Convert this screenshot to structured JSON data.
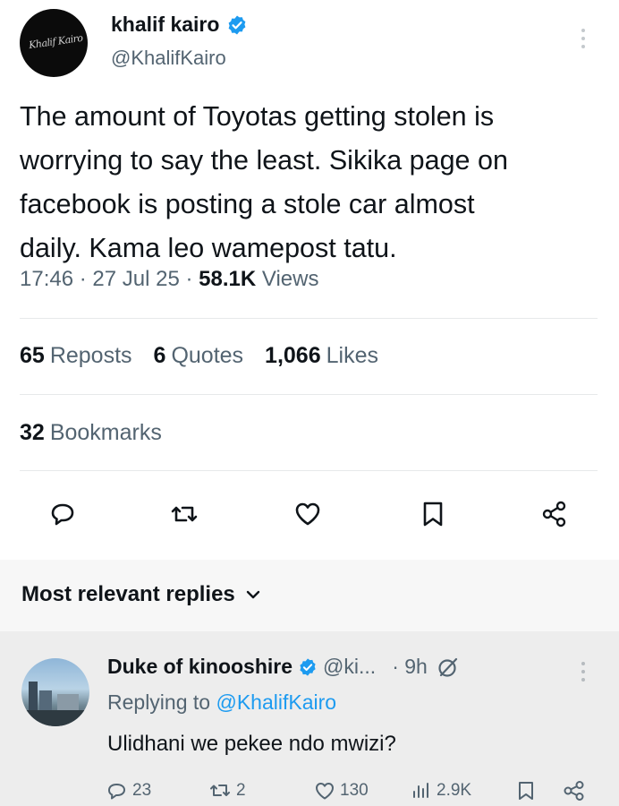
{
  "post": {
    "author": {
      "name": "khalif kairo",
      "handle": "@KhalifKairo",
      "avatar_signature": "Khalif Kairo"
    },
    "text": "The amount of Toyotas getting stolen is\nworrying to say the least. Sikika page on\nfacebook is posting a stole  car almost\ndaily. Kama leo wamepost tatu.",
    "time": "17:46",
    "date": "27 Jul 25",
    "separator": "·",
    "views_count": "58.1K",
    "views_label": "Views",
    "stats": [
      {
        "count": "65",
        "label": "Reposts"
      },
      {
        "count": "6",
        "label": "Quotes"
      },
      {
        "count": "1,066",
        "label": "Likes"
      }
    ],
    "bookmarks": {
      "count": "32",
      "label": "Bookmarks"
    },
    "actions": [
      "reply-icon",
      "repost-icon",
      "like-icon",
      "bookmark-icon",
      "share-icon"
    ]
  },
  "replies_section": {
    "title": "Most relevant replies"
  },
  "reply": {
    "name": "Duke of kinooshire",
    "handle": "@ki...",
    "time": "· 9h",
    "replying_prefix": "Replying to",
    "replying_to": "@KhalifKairo",
    "text": "Ulidhani we pekee ndo mwizi?",
    "replies": "23",
    "reposts": "2",
    "likes": "130",
    "views": "2.9K"
  },
  "colors": {
    "text": "#0f1419",
    "muted": "#536471",
    "accent": "#1d9bf0",
    "divider": "#e7e9ea"
  }
}
